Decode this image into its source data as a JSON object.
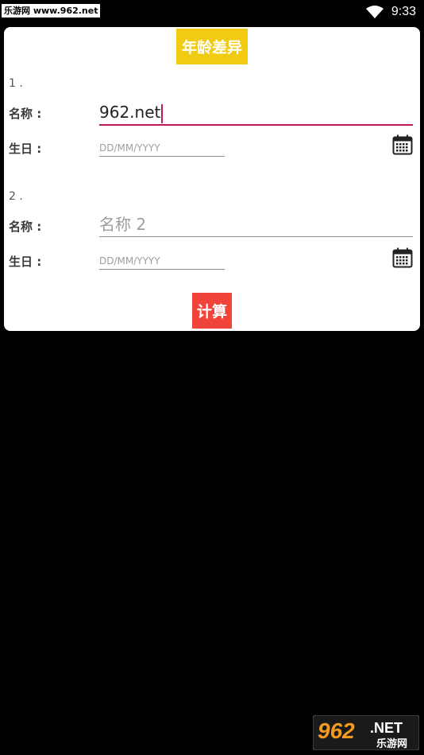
{
  "status_bar": {
    "watermark": "乐游网 www.962.net",
    "time": "9:33",
    "icons": [
      "wifi-icon",
      "battery-icon"
    ]
  },
  "app": {
    "title": "年龄差异",
    "title_color": "#f1cb12",
    "accent_color": "#c2185b"
  },
  "entries": [
    {
      "number": "1 .",
      "name_label": "名称 :",
      "name_value": "962.net",
      "name_placeholder": "",
      "birthday_label": "生日 :",
      "birthday_placeholder": "DD/MM/YYYY"
    },
    {
      "number": "2 .",
      "name_label": "名称 :",
      "name_value": "",
      "name_placeholder": "名称 2",
      "birthday_label": "生日 :",
      "birthday_placeholder": "DD/MM/YYYY"
    }
  ],
  "calculate_button": {
    "label": "计算",
    "color": "#f0443a"
  },
  "bottom_watermark": {
    "brand": "962",
    "suffix": ".NET",
    "sub": "乐游网"
  }
}
